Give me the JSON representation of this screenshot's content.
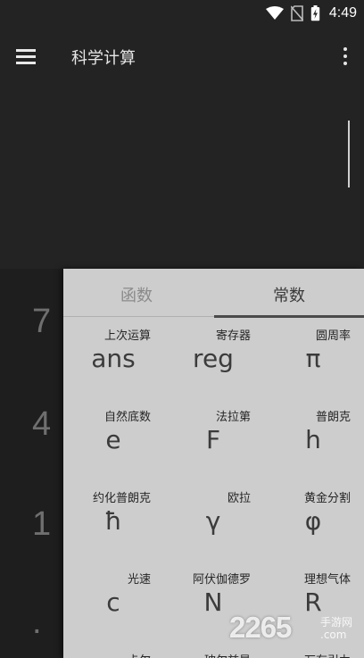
{
  "status": {
    "time": "4:49"
  },
  "toolbar": {
    "title": "科学计算"
  },
  "keypad": {
    "digits": [
      "7",
      "4",
      "1",
      "."
    ]
  },
  "tabs": [
    {
      "label": "函数",
      "active": false
    },
    {
      "label": "常数",
      "active": true
    }
  ],
  "constants": [
    {
      "label": "上次运算",
      "symbol": "ans"
    },
    {
      "label": "寄存器",
      "symbol": "reg"
    },
    {
      "label": "圆周率",
      "symbol": "π"
    },
    {
      "label": "自然底数",
      "symbol": "e"
    },
    {
      "label": "法拉第",
      "symbol": "F"
    },
    {
      "label": "普朗克",
      "symbol": "h"
    },
    {
      "label": "约化普朗克",
      "symbol": "ħ"
    },
    {
      "label": "欧拉",
      "symbol": "γ"
    },
    {
      "label": "黄金分割",
      "symbol": "φ"
    },
    {
      "label": "光速",
      "symbol": "c"
    },
    {
      "label": "阿伏伽德罗",
      "symbol": "N"
    },
    {
      "label": "理想气体",
      "symbol": "R"
    },
    {
      "label": "卡尔",
      "symbol": ""
    },
    {
      "label": "玻尔兹曼",
      "symbol": ""
    },
    {
      "label": "万有引力",
      "symbol": ""
    }
  ],
  "watermark": {
    "text": "2265",
    "sub1": "手游网",
    "sub2": ".com"
  }
}
